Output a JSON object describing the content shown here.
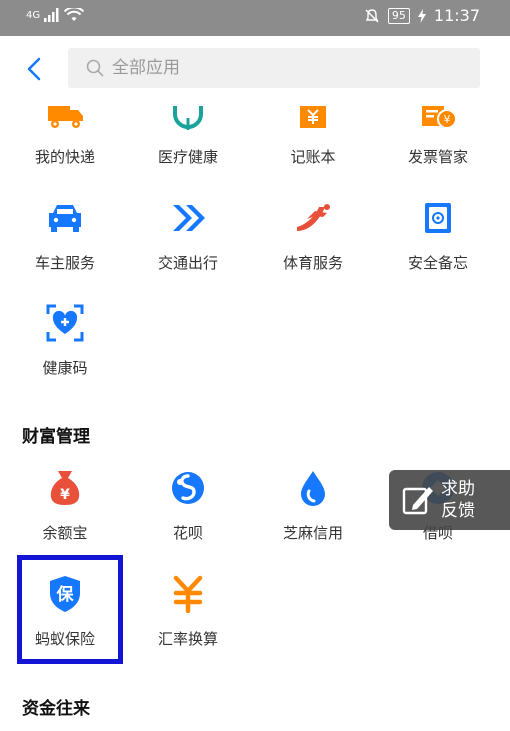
{
  "status_bar": {
    "network": "4G",
    "battery": "95",
    "time": "11:37"
  },
  "search": {
    "placeholder": "全部应用"
  },
  "rows": {
    "row1": [
      "我的快递",
      "医疗健康",
      "记账本",
      "发票管家"
    ],
    "row2": [
      "车主服务",
      "交通出行",
      "体育服务",
      "安全备忘"
    ],
    "row3": [
      "健康码"
    ]
  },
  "sections": {
    "wealth": {
      "title": "财富管理",
      "row1": [
        "余额宝",
        "花呗",
        "芝麻信用",
        "借呗"
      ],
      "row2": [
        "蚂蚁保险",
        "汇率换算"
      ]
    },
    "funds": {
      "title": "资金往来"
    }
  },
  "float_help": {
    "line1": "求助",
    "line2": "反馈"
  },
  "colors": {
    "accent": "#1677ff",
    "orange": "#ff8a00",
    "red": "#e8503a",
    "highlight": "#1414d4"
  }
}
